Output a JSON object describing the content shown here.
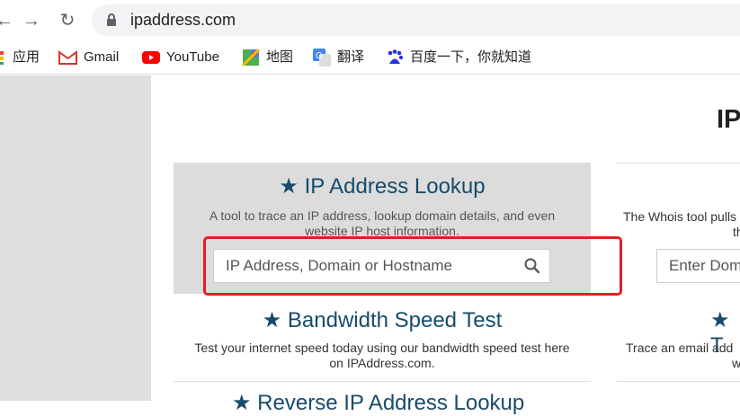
{
  "browser": {
    "url": "ipaddress.com",
    "bookmarks": [
      {
        "label": "应用",
        "icon": "apps-icon"
      },
      {
        "label": "Gmail",
        "icon": "gmail-icon"
      },
      {
        "label": "YouTube",
        "icon": "youtube-icon"
      },
      {
        "label": "地图",
        "icon": "maps-icon"
      },
      {
        "label": "翻译",
        "icon": "translate-icon"
      },
      {
        "label": "百度一下，你就知道",
        "icon": "baidu-icon"
      }
    ]
  },
  "page": {
    "title_partial": "IP",
    "lookup": {
      "title": "★ IP Address Lookup",
      "desc_line1": "A tool to trace an IP address, lookup domain details, and even",
      "desc_line2": "website IP host information.",
      "placeholder": "IP Address, Domain or Hostname"
    },
    "speed": {
      "title": "★ Bandwidth Speed Test",
      "desc_line1": "Test your internet speed today using our bandwidth speed test here",
      "desc_line2": "on IPAddress.com."
    },
    "reverse_partial": "★ Reverse IP Address Lookup",
    "whois": {
      "desc_line1": "The Whois tool pulls",
      "desc_line2": "th",
      "placeholder": "Enter Dom"
    },
    "email": {
      "star": "★ T",
      "desc_line1": "Trace an email add",
      "desc_line2": "w"
    }
  },
  "colors": {
    "highlight": "#e31f1f",
    "title": "#174b6c"
  }
}
